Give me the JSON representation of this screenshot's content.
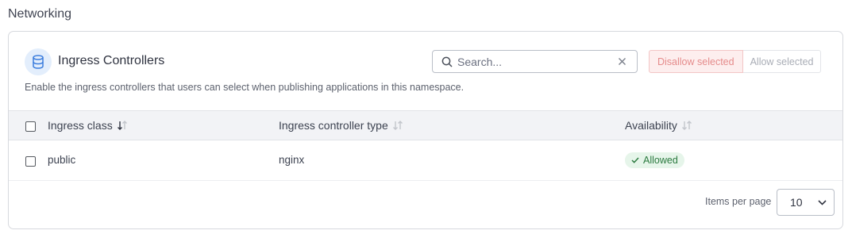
{
  "section": {
    "title": "Networking"
  },
  "card": {
    "title": "Ingress Controllers",
    "description": "Enable the ingress controllers that users can select when publishing applications in this namespace.",
    "icon": "database-icon"
  },
  "search": {
    "placeholder": "Search...",
    "value": ""
  },
  "actions": {
    "disallow_label": "Disallow selected",
    "allow_label": "Allow selected"
  },
  "table": {
    "columns": [
      {
        "label": "Ingress class",
        "sort": "desc"
      },
      {
        "label": "Ingress controller type",
        "sort": "none"
      },
      {
        "label": "Availability",
        "sort": "none"
      }
    ],
    "rows": [
      {
        "class": "public",
        "type": "nginx",
        "availability": "Allowed",
        "checked": false
      }
    ]
  },
  "pagination": {
    "items_per_page_label": "Items per page",
    "items_per_page": "10"
  },
  "colors": {
    "accent": "#2563eb",
    "allowed_bg": "#e6f5ea",
    "allowed_text": "#2b7a3f",
    "danger_text": "#e58b8b"
  }
}
